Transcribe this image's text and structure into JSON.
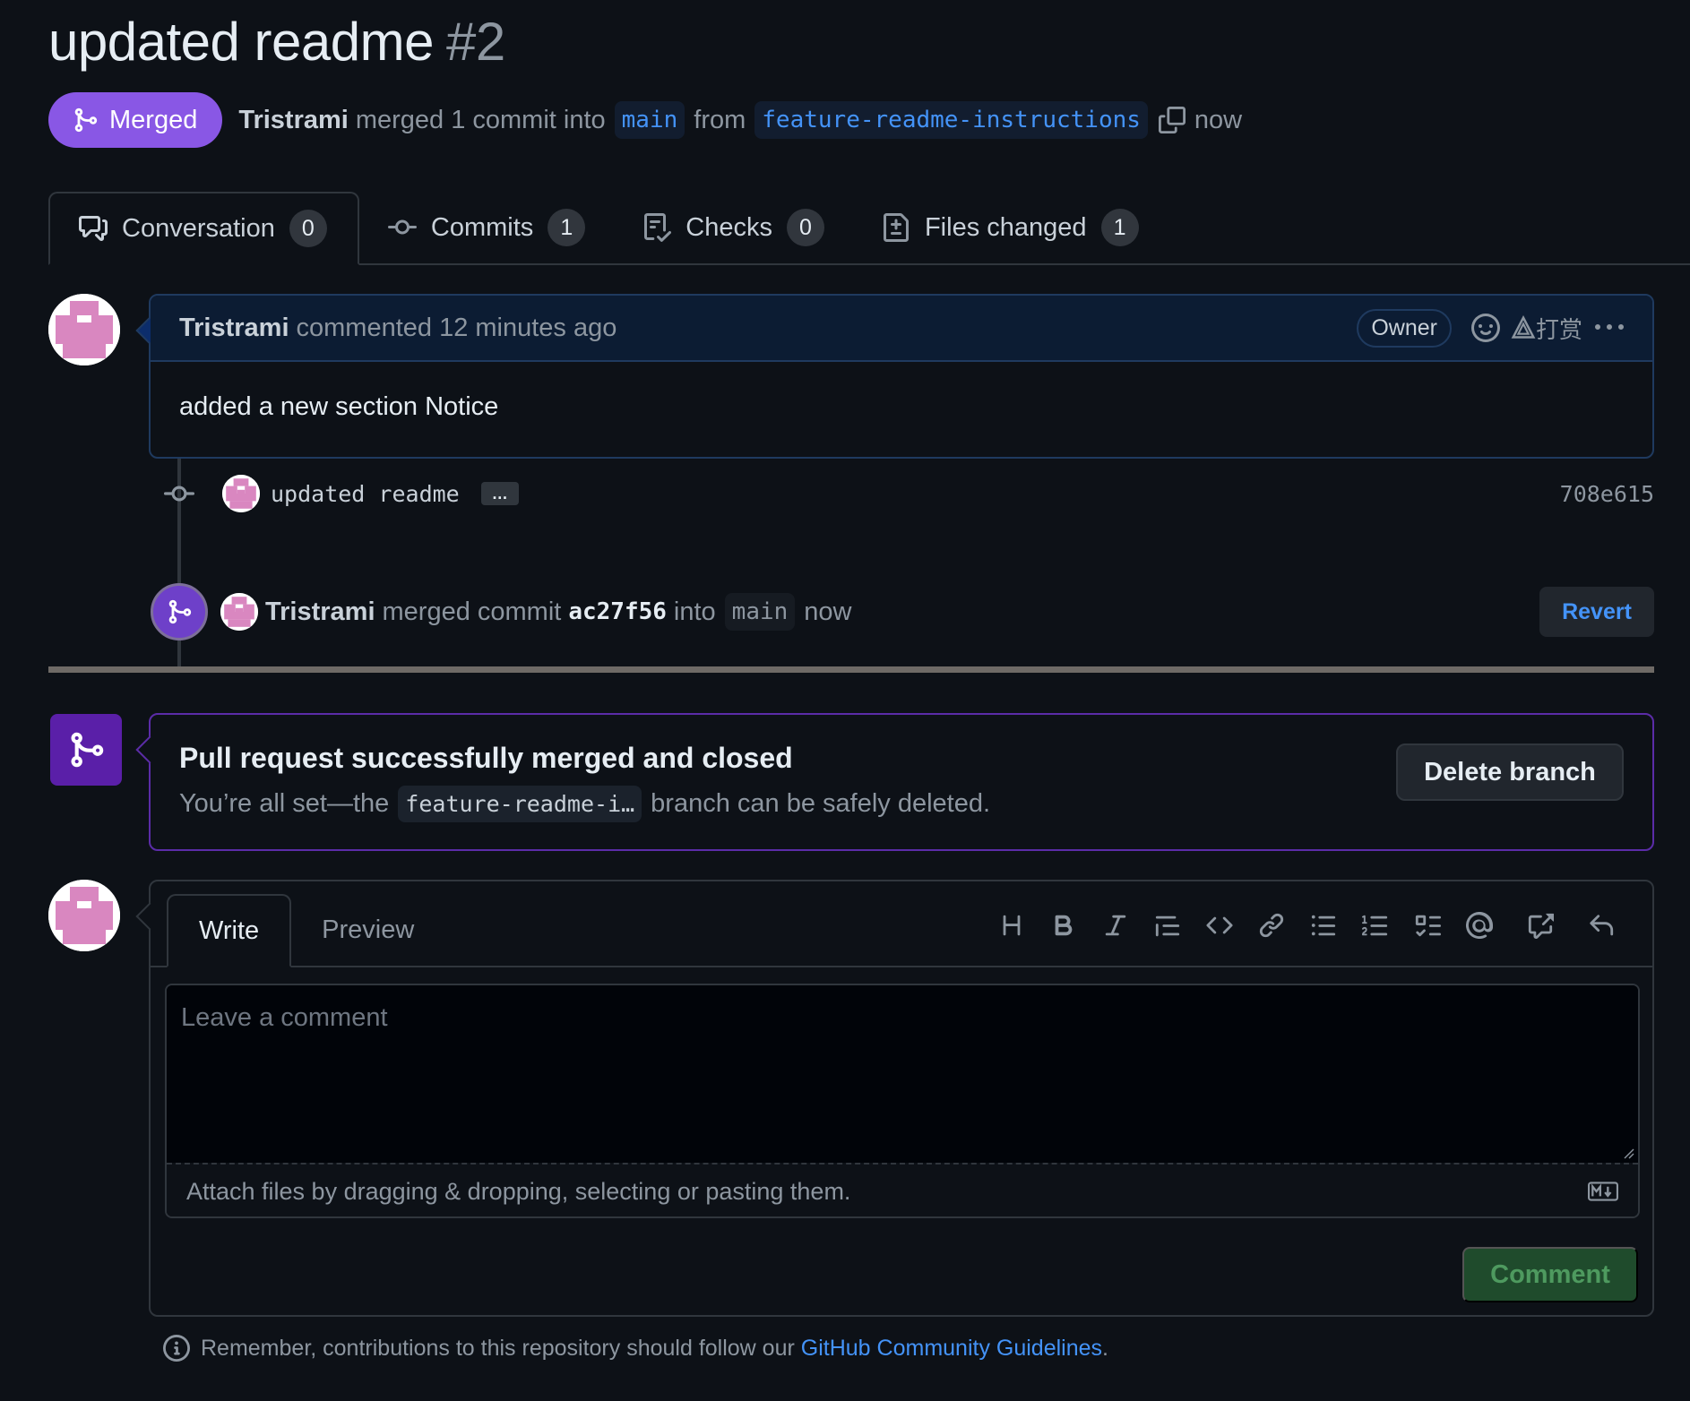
{
  "pr": {
    "title": "updated readme",
    "number": "#2",
    "state": "Merged",
    "author": "Tristrami",
    "merge_text": "merged 1 commit into",
    "base_branch": "main",
    "from_text": "from",
    "head_branch": "feature-readme-instructions",
    "time": "now"
  },
  "tabs": [
    {
      "label": "Conversation",
      "count": "0",
      "icon": "comment-discussion-icon"
    },
    {
      "label": "Commits",
      "count": "1",
      "icon": "git-commit-icon"
    },
    {
      "label": "Checks",
      "count": "0",
      "icon": "checklist-icon"
    },
    {
      "label": "Files changed",
      "count": "1",
      "icon": "file-diff-icon"
    }
  ],
  "comment": {
    "author": "Tristrami",
    "action": "commented 12 minutes ago",
    "role": "Owner",
    "reward_label": "打赏",
    "body": "added a new section Notice"
  },
  "commit": {
    "message": "updated readme",
    "expand_label": "…",
    "sha": "708e615"
  },
  "merge_event": {
    "author": "Tristrami",
    "text": "merged commit",
    "sha": "ac27f56",
    "into_text": "into",
    "branch": "main",
    "time": "now",
    "revert_label": "Revert"
  },
  "merged_box": {
    "title": "Pull request successfully merged and closed",
    "desc_before": "You’re all set—the",
    "branch": "feature-readme-i…",
    "desc_after": "branch can be safely deleted.",
    "delete_label": "Delete branch"
  },
  "editor": {
    "write_tab": "Write",
    "preview_tab": "Preview",
    "placeholder": "Leave a comment",
    "attach_text": "Attach files by dragging & dropping, selecting or pasting them.",
    "submit_label": "Comment",
    "toolbar": [
      "heading-icon",
      "bold-icon",
      "italic-icon",
      "quote-icon",
      "code-icon",
      "link-icon",
      "unordered-list-icon",
      "ordered-list-icon",
      "task-list-icon",
      "mention-icon",
      "cross-reference-icon",
      "undo-icon"
    ]
  },
  "footer": {
    "text": "Remember, contributions to this repository should follow our",
    "link": "GitHub Community Guidelines",
    "period": "."
  },
  "colors": {
    "merged_purple": "#8957e5",
    "link_blue": "#4493f8",
    "comment_green": "#1f4b2c",
    "avatar_pink": "#d987c0"
  }
}
